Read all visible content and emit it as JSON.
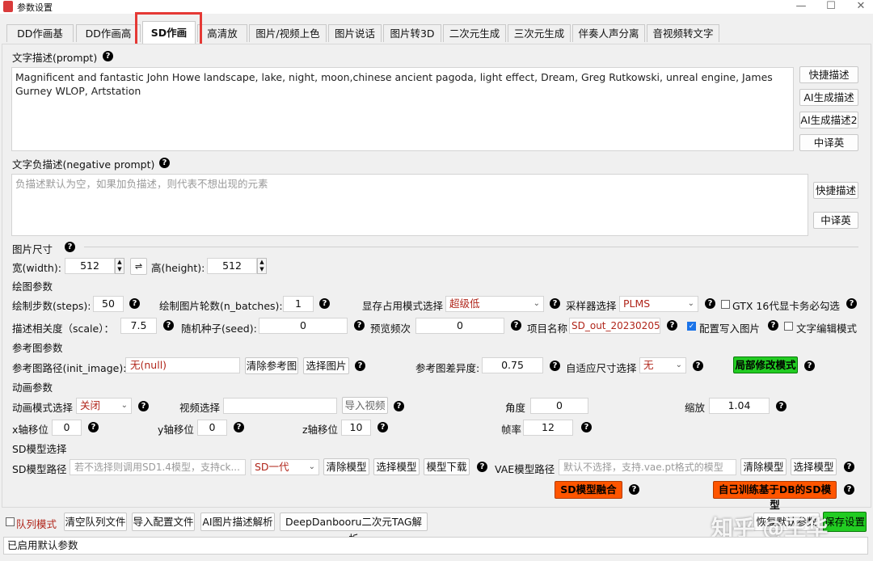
{
  "window": {
    "title": "参数设置",
    "min": "—",
    "max": "☐",
    "close": "✕"
  },
  "tabs": [
    "DD作画基本",
    "DD作画高级",
    "SD作画",
    "高清放大",
    "图片/视频上色",
    "图片说话",
    "图片转3D",
    "二次元生成",
    "三次元生成",
    "伴奏人声分离",
    "音视频转文字"
  ],
  "prompt": {
    "label": "文字描述(prompt)",
    "value": "Magnificent and fantastic John Howe landscape, lake, night, moon,chinese ancient pagoda, light effect, Dream, Greg Rutkowski, unreal engine, James Gurney WLOP, Artstation",
    "buttons": [
      "快捷描述",
      "AI生成描述",
      "AI生成描述2",
      "中译英"
    ]
  },
  "negative": {
    "label": "文字负描述(negative prompt)",
    "placeholder": "负描述默认为空，如果加负描述，则代表不想出现的元素",
    "buttons": [
      "快捷描述",
      "中译英"
    ]
  },
  "size": {
    "label": "图片尺寸",
    "width_label": "宽(width):",
    "width": "512",
    "swap": "⇌",
    "height_label": "高(height):",
    "height": "512"
  },
  "draw": {
    "label": "绘图参数",
    "steps_label": "绘制步数(steps):",
    "steps": "50",
    "batches_label": "绘制图片轮数(n_batches):",
    "batches": "1",
    "vram_label": "显存占用模式选择",
    "vram": "超级低",
    "sampler_label": "采样器选择",
    "sampler": "PLMS",
    "gtx_label": "GTX 16代显卡务必勾选",
    "scale_label": "描述相关度（scale）：",
    "scale": "7.5",
    "seed_label": "随机种子(seed):",
    "seed": "0",
    "preview_label": "预览频次",
    "preview": "0",
    "project_label": "项目名称",
    "project": "SD_out_20230205",
    "write_cfg_label": "配置写入图片",
    "text_edit_label": "文字编辑模式"
  },
  "ref": {
    "label": "参考图参数",
    "path_label": "参考图路径(init_image):",
    "path": "无(null)",
    "clear_btn": "清除参考图",
    "choose_btn": "选择图片",
    "strength_label": "参考图差异度:",
    "strength": "0.75",
    "fit_label": "自适应尺寸选择",
    "fit": "无",
    "inpaint_btn": "局部修改模式"
  },
  "anim": {
    "label": "动画参数",
    "mode_label": "动画模式选择",
    "mode": "关闭",
    "video_label": "视频选择",
    "video": "",
    "import_btn": "导入视频",
    "angle_label": "角度",
    "angle": "0",
    "zoom_label": "缩放",
    "zoom": "1.04",
    "x_label": "x轴移位",
    "x": "0",
    "y_label": "y轴移位",
    "y": "0",
    "z_label": "z轴移位",
    "z": "10",
    "fps_label": "帧率",
    "fps": "12"
  },
  "model": {
    "label": "SD模型选择",
    "path_label": "SD模型路径",
    "path_placeholder": "若不选择则调用SD1.4模型，支持ck...",
    "version": "SD一代",
    "clear_btn": "清除模型",
    "choose_btn": "选择模型",
    "download_btn": "模型下载",
    "vae_label": "VAE模型路径",
    "vae_placeholder": "默认不选择，支持.vae.pt格式的模型",
    "vae_clear_btn": "清除模型",
    "vae_choose_btn": "选择模型",
    "merge_btn": "SD模型融合",
    "db_btn": "自己训练基于DB的SD模型"
  },
  "bottom": {
    "queue_label": "队列模式",
    "clear_queue": "清空队列文件",
    "import_cfg": "导入配置文件",
    "ai_parse": "AI图片描述解析",
    "dd_parse": "DeepDanbooru二次元TAG解析",
    "reset": "恢复默认参数",
    "save": "保存设置"
  },
  "status": "已启用默认参数",
  "watermark": "知乎 @王华"
}
